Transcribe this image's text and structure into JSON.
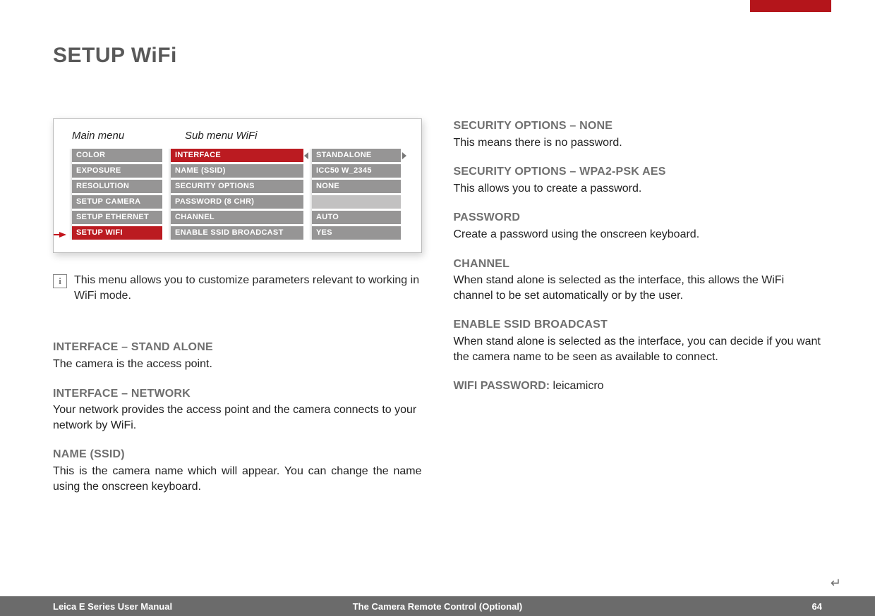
{
  "title": "SETUP WiFi",
  "menu": {
    "label_main": "Main menu",
    "label_sub": "Sub menu WiFi",
    "main_items": [
      "COLOR",
      "EXPOSURE",
      "RESOLUTION",
      "SETUP CAMERA",
      "SETUP ETHERNET",
      "SETUP WIFI"
    ],
    "sub_items": [
      "INTERFACE",
      "NAME (SSID)",
      "SECURITY OPTIONS",
      "PASSWORD (8 CHR)",
      "CHANNEL",
      "ENABLE SSID BROADCAST"
    ],
    "values": [
      "STANDALONE",
      "ICC50 W_2345",
      "NONE",
      "",
      "AUTO",
      "YES"
    ]
  },
  "info_note": "This menu allows you to customize parameters relevant to working in WiFi mode.",
  "left_sections": [
    {
      "h": "INTERFACE – STAND ALONE",
      "p": "The camera is the access point."
    },
    {
      "h": "INTERFACE – NETWORK",
      "p": "Your network provides the access point and the camera connects to your network by WiFi."
    },
    {
      "h": "NAME (SSID)",
      "p": "This is the camera name which will appear. You can change the name using the onscreen keyboard."
    }
  ],
  "right_sections": [
    {
      "h": "SECURITY OPTIONS – NONE",
      "p": "This means there is no password."
    },
    {
      "h": "SECURITY OPTIONS – WPA2-PSK AES",
      "p": "This allows you to create a password."
    },
    {
      "h": "PASSWORD",
      "p": "Create a password using the onscreen keyboard."
    },
    {
      "h": "CHANNEL",
      "p": "When stand alone is selected as the interface, this allows the WiFi channel to be set automatically or by the user."
    },
    {
      "h": "ENABLE SSID BROADCAST",
      "p": "When stand alone is selected as the interface, you can decide if you want the camera name to be seen as available to connect."
    }
  ],
  "wifi_pw_label": "WIFI PASSWORD: ",
  "wifi_pw_value": "leicamicro",
  "footer": {
    "left": "Leica E Series User Manual",
    "center": "The Camera Remote Control (Optional)",
    "page": "64"
  },
  "return_glyph": "↵"
}
